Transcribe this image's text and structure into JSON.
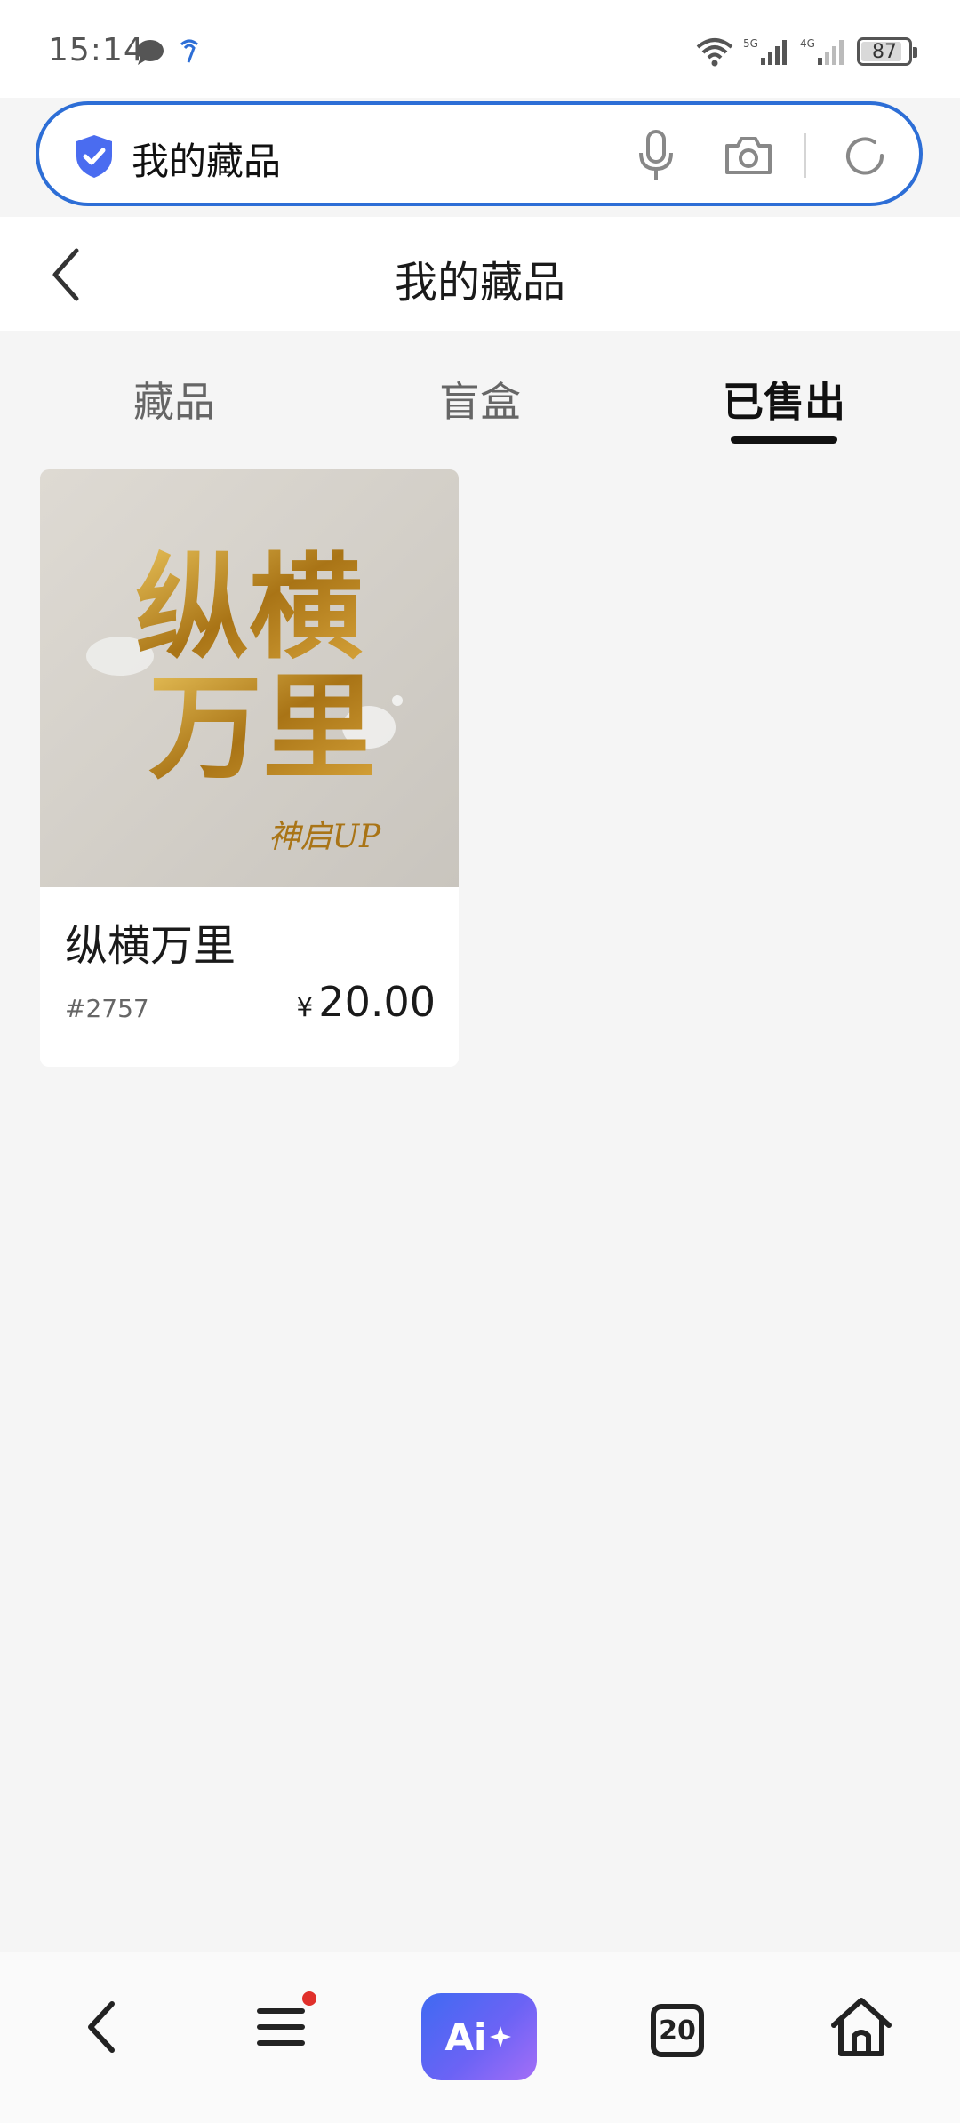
{
  "status_bar": {
    "time": "15:14",
    "network_5g": "5G",
    "network_4g": "4G",
    "battery": "87"
  },
  "search": {
    "text": "我的藏品"
  },
  "header": {
    "title": "我的藏品"
  },
  "tabs": [
    {
      "label": "藏品",
      "active": false
    },
    {
      "label": "盲盒",
      "active": false
    },
    {
      "label": "已售出",
      "active": true
    }
  ],
  "items": [
    {
      "title": "纵横万里",
      "serial": "#2757",
      "currency": "¥",
      "price": "20.00",
      "image_text": {
        "line1": "纵横",
        "line2": "万里",
        "signature": "神启UP"
      }
    }
  ],
  "bottom_nav": {
    "ai_label": "Ai",
    "tab_count": "20"
  },
  "colors": {
    "accent": "#2d6ed6",
    "gold": "#b8860b",
    "badge_red": "#e0302b"
  }
}
